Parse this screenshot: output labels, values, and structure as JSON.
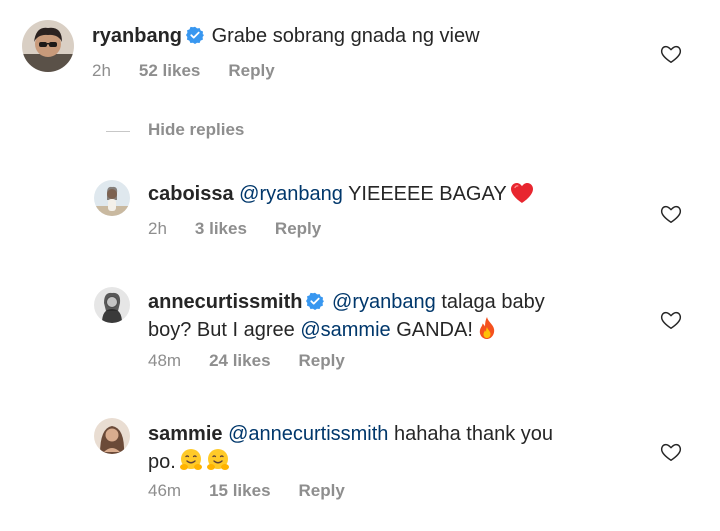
{
  "comments": [
    {
      "username": "ryanbang",
      "verified": true,
      "text": "Grabe sobrang gnada ng view",
      "time": "2h",
      "likes": "52 likes",
      "reply": "Reply"
    },
    {
      "username": "caboissa",
      "mention": "@ryanbang",
      "text": "YIEEEEE BAGAY",
      "time": "2h",
      "likes": "3 likes",
      "reply": "Reply"
    },
    {
      "username": "annecurtissmith",
      "verified": true,
      "mention": "@ryanbang",
      "text_1": "talaga baby",
      "text_2": "boy? But I agree",
      "mention_2": "@sammie",
      "text_3": "GANDA!",
      "time": "48m",
      "likes": "24 likes",
      "reply": "Reply"
    },
    {
      "username": "sammie",
      "mention": "@annecurtissmith",
      "text_1": "hahaha thank you",
      "text_2": "po.",
      "time": "46m",
      "likes": "15 likes",
      "reply": "Reply"
    }
  ],
  "hide_replies_label": "Hide replies",
  "icons": {
    "like": "heart-outline-icon",
    "verified": "verified-badge-icon",
    "emojis": [
      "red-heart-emoji",
      "fire-emoji",
      "hugging-face-emoji"
    ]
  },
  "colors": {
    "text": "#262626",
    "meta": "#8e8e8e",
    "mention": "#00376b",
    "verified": "#3897f0"
  }
}
